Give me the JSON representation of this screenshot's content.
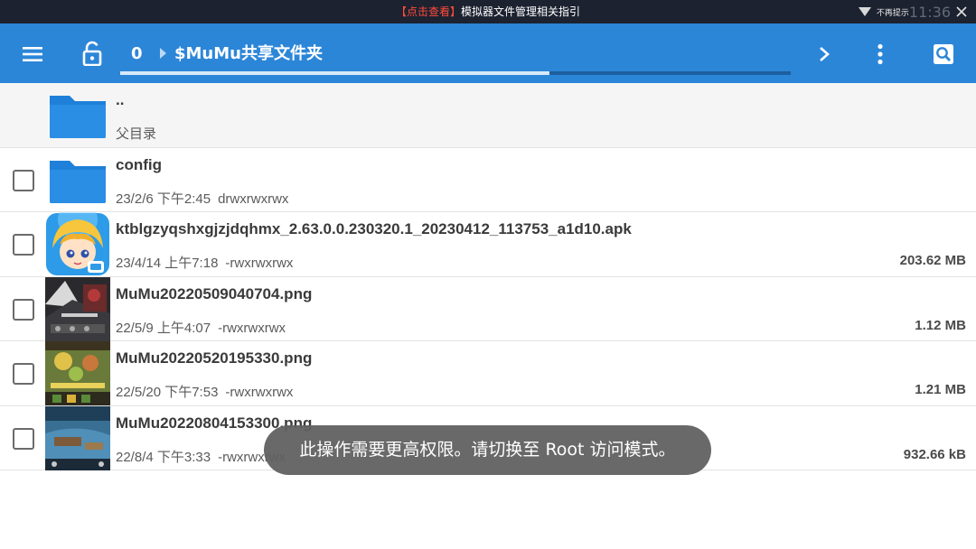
{
  "statusbar": {
    "notice_tag": "【点击查看】",
    "notice_text": "模拟器文件管理相关指引",
    "dismiss_label": "不再提示",
    "clock": "11:36"
  },
  "toolbar": {
    "crumb_count": "0",
    "crumb_path": "$MuMu共享文件夹",
    "scroll_progress": 0.64,
    "color": "#2c86d8"
  },
  "files": [
    {
      "type": "parent",
      "name": "..",
      "meta": "父目录",
      "perm": "",
      "size": "",
      "icon": "folder-icon"
    },
    {
      "type": "folder",
      "name": "config",
      "meta": "23/2/6 下午2:45",
      "perm": "drwxrwxrwx",
      "size": "",
      "icon": "folder-icon"
    },
    {
      "type": "apk",
      "name": "ktblgzyqshxgjzjdqhmx_2.63.0.0.230320.1_20230412_113753_a1d10.apk",
      "meta": "23/4/14 上午7:18",
      "perm": "-rwxrwxrwx",
      "size": "203.62 MB",
      "icon": "app-icon"
    },
    {
      "type": "image",
      "name": "MuMu20220509040704.png",
      "meta": "22/5/9 上午4:07",
      "perm": "-rwxrwxrwx",
      "size": "1.12 MB",
      "icon": "image-thumbnail"
    },
    {
      "type": "image",
      "name": "MuMu20220520195330.png",
      "meta": "22/5/20 下午7:53",
      "perm": "-rwxrwxrwx",
      "size": "1.21 MB",
      "icon": "image-thumbnail"
    },
    {
      "type": "image",
      "name": "MuMu20220804153300.png",
      "meta": "22/8/4 下午3:33",
      "perm": "-rwxrwxrwx",
      "size": "932.66 kB",
      "icon": "image-thumbnail"
    }
  ],
  "toast": "此操作需要更高权限。请切换至 Root 访问模式。",
  "colors": {
    "accent": "#2c86d8",
    "folder": "#1e80d8",
    "statusbar": "#1c2230",
    "notice_red": "#ff4b3a"
  }
}
